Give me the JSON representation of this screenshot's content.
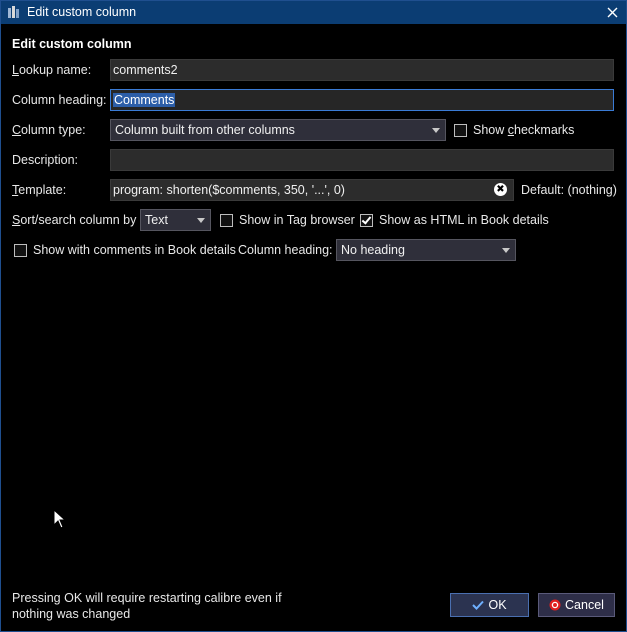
{
  "window": {
    "title": "Edit custom column"
  },
  "form": {
    "heading": "Edit custom column",
    "lookup_label_u": "L",
    "lookup_label_rest": "ookup name:",
    "lookup_value": "comments2",
    "heading_label": "Column heading:",
    "heading_value": "Comments",
    "type_label_u": "C",
    "type_label_rest": "olumn type:",
    "type_value": "Column built from other columns",
    "show_checkmarks_pre": "Show ",
    "show_checkmarks_u": "c",
    "show_checkmarks_rest": "heckmarks",
    "show_checkmarks_checked": false,
    "description_label": "Description:",
    "description_value": "",
    "template_label_u": "T",
    "template_label_rest": "emplate:",
    "template_value": "program: shorten($comments, 350, '...', 0)",
    "template_default": "Default: (nothing)",
    "sort_label_u": "S",
    "sort_label_rest": "ort/search column by",
    "sort_value": "Text",
    "show_tag_browser": "Show in Tag browser",
    "show_tag_browser_checked": false,
    "show_html": "Show as HTML in Book details",
    "show_html_checked": true,
    "show_comments": "Show with comments in Book details",
    "show_comments_checked": false,
    "column_heading2_label": "Column heading:",
    "column_heading2_value": "No heading"
  },
  "footer": {
    "note": "Pressing OK will require restarting calibre even if nothing was changed",
    "ok_label": "OK",
    "cancel_label": "Cancel"
  },
  "colors": {
    "titlebar": "#0b3d73",
    "accent": "#3a7bd5",
    "cancel_icon": "#e02020"
  }
}
